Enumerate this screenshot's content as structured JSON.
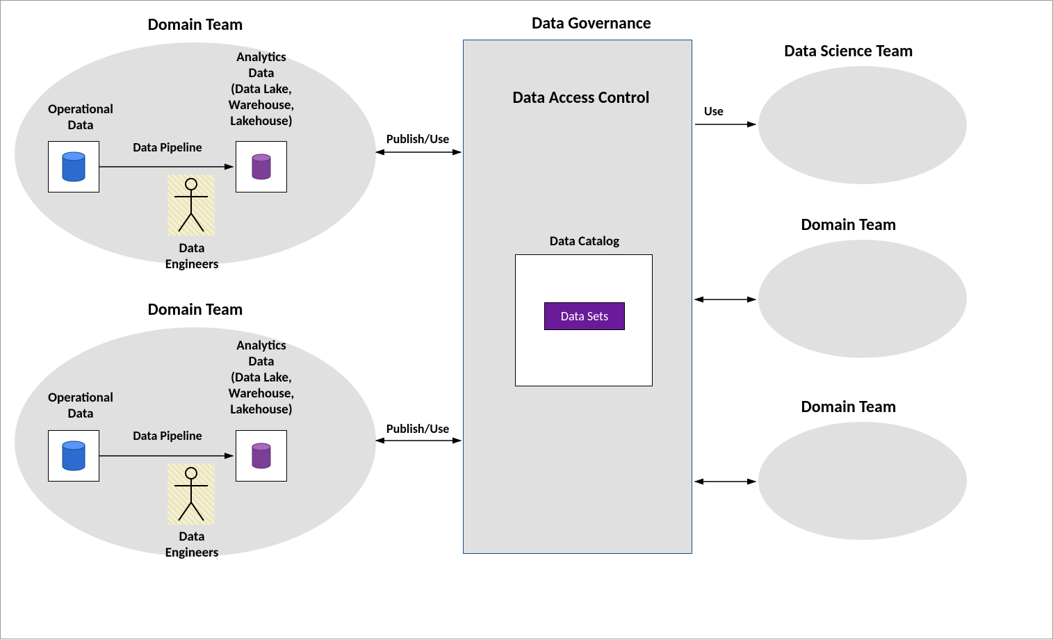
{
  "domainTeam1": {
    "title": "Domain Team",
    "operationalData": "Operational\nData",
    "analyticsData": "Analytics\nData\n(Data Lake,\nWarehouse,\nLakehouse)",
    "pipeline": "Data Pipeline",
    "engineers": "Data\nEngineers"
  },
  "domainTeam2": {
    "title": "Domain Team",
    "operationalData": "Operational\nData",
    "analyticsData": "Analytics\nData\n(Data Lake,\nWarehouse,\nLakehouse)",
    "pipeline": "Data Pipeline",
    "engineers": "Data\nEngineers"
  },
  "governance": {
    "title": "Data Governance",
    "accessControl": "Data Access Control",
    "catalog": "Data Catalog",
    "dataSets": "Data Sets"
  },
  "consumers": {
    "dataScience": "Data Science Team",
    "domainTeamA": "Domain Team",
    "domainTeamB": "Domain Team"
  },
  "connectors": {
    "publishUse1": "Publish/Use",
    "publishUse2": "Publish/Use",
    "use": "Use"
  }
}
